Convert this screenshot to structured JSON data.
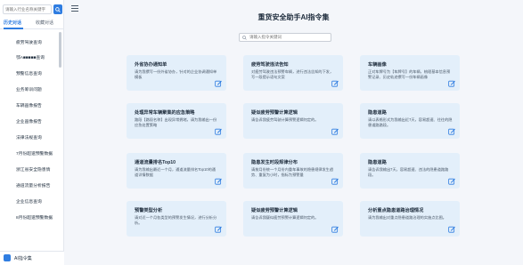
{
  "sidebar": {
    "search_placeholder": "请输入行业名称关键字",
    "tabs": [
      {
        "label": "历史对话",
        "active": true
      },
      {
        "label": "收藏对话",
        "active": false
      }
    ],
    "history": [
      "疲劳驾驶查询",
      "鄂A■■■■■查询",
      "预警信息查询",
      "业务筹训问题",
      "车辆画像报告",
      "企业画像报告",
      "法律法规查询",
      "7月份超速预警数据",
      "浙江省安全隐患情",
      "通道流量分析报告",
      "企业信息查询",
      "8月份超速预警数据"
    ],
    "footer_label": "AI指令集"
  },
  "main": {
    "title": "重货安全助手AI指令集",
    "search_placeholder": "请输入指令关键词"
  },
  "cards": [
    {
      "title": "外省协办通知单",
      "desc": "请为我撰写一份外省协办，针对的企业协调通知单模板"
    },
    {
      "title": "疲劳驾驶违法告知",
      "desc": "对疲劳驾驶违法预警车辆，进行违法告知的下发，写一段提示语句文案"
    },
    {
      "title": "车辆画像",
      "desc": "正对车牌号为【车牌号】的车辆，梳理基本信息预警记录、历史轨迹撰写一份车辆画像"
    },
    {
      "title": "处理异常车辆聚集的应急策略",
      "desc": "路段【路段名称】出现异常拥堵，请为我输出一份应急处置策略"
    },
    {
      "title": "疑似疲劳预警计算逻辑",
      "desc": "请告诉我疲劳驾驶计算预警逻辑何定的。"
    },
    {
      "title": "隐患道路",
      "desc": "请以表格形式为我输出近7天，容易超速、往往的隐患道路路段。"
    },
    {
      "title": "通道流量排名Top10",
      "desc": "请为我输出最近一个月，通道流量排名Top10的通道详情数据"
    },
    {
      "title": "隐患发生时段规律分布",
      "desc": "请按月份统一个月份内重车事故的隐患规律发生趋势、重复为小时，指标为预警量"
    },
    {
      "title": "隐患道路",
      "desc": "请告诉我输出7天，容易超速、违法的隐患道路路段。"
    },
    {
      "title": "预警类型分析",
      "desc": "请对近一个月各类型的预警发生情况，进行分析分析。"
    },
    {
      "title": "疑似疲劳预警计算逻辑",
      "desc": "请告诉我疑似疲劳预警计算逻辑何定的。"
    },
    {
      "title": "分析重点隐患道路治理情况",
      "desc": "请为我输出对重点隐患道路治理的实施点比图。"
    }
  ],
  "colors": {
    "accent": "#2f7de1",
    "card_bg": "#e3effa",
    "page_bg": "#f4f6fa"
  }
}
